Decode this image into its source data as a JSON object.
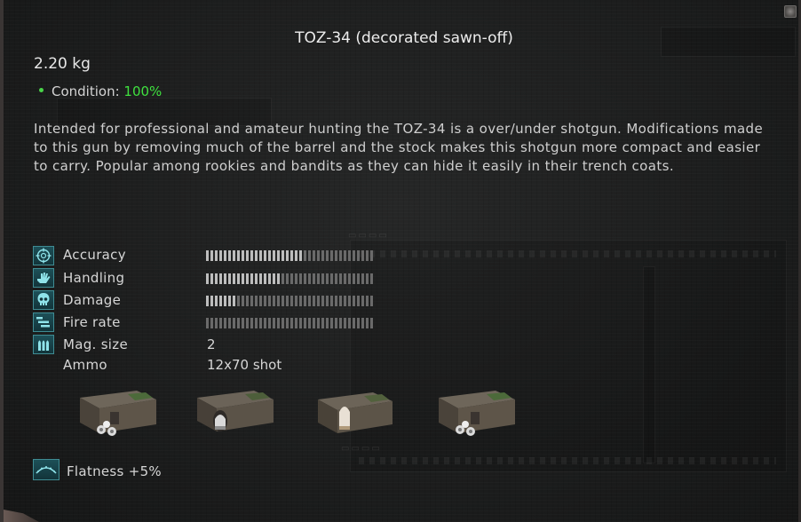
{
  "item": {
    "title": "TOZ-34 (decorated sawn-off)",
    "weight": "2.20 kg",
    "condition_label": "Condition:",
    "condition_value": "100%",
    "description": "Intended for professional and amateur hunting the TOZ-34 is a over/under shotgun. Modifications made to this gun by removing much of the barrel and the stock makes this shotgun more compact and easier to carry. Popular among rookies and bandits as they can hide it easily in their trench coats."
  },
  "stats": [
    {
      "label": "Accuracy",
      "icon": "crosshair-icon",
      "bar_fraction": 0.58
    },
    {
      "label": "Handling",
      "icon": "hand-icon",
      "bar_fraction": 0.46
    },
    {
      "label": "Damage",
      "icon": "skull-icon",
      "bar_fraction": 0.18
    },
    {
      "label": "Fire rate",
      "icon": "fire-rate-icon",
      "bar_fraction": 0.0
    }
  ],
  "magazine": {
    "label": "Mag. size",
    "icon": "bullets-icon",
    "value": "2"
  },
  "ammo": {
    "label": "Ammo",
    "value": "12x70 shot"
  },
  "ammo_types": [
    {
      "icon": "buckshot-box-icon"
    },
    {
      "icon": "slug-box-icon"
    },
    {
      "icon": "dart-box-icon"
    },
    {
      "icon": "buckshot-box-icon"
    }
  ],
  "upgrade": {
    "icon": "flatness-icon",
    "text": "Flatness +5%"
  },
  "colors": {
    "condition_good": "#3fe03f",
    "bar_filled": "#bdbdbd",
    "bar_empty": "#6a6a6a",
    "icon_accent": "#3f8c93"
  }
}
